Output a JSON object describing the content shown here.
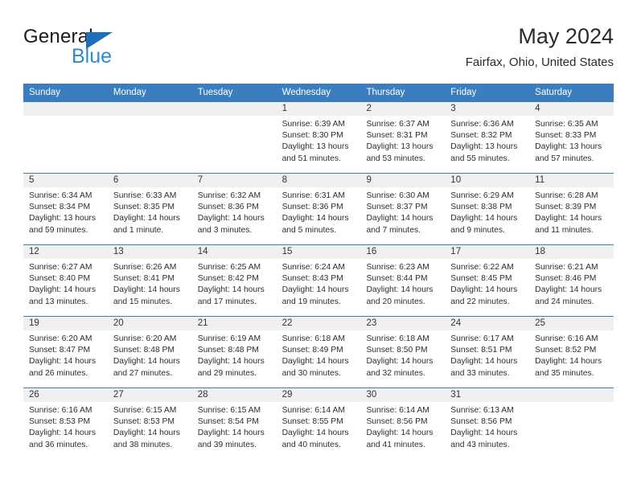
{
  "brand": {
    "name_part1": "General",
    "name_part2": "Blue",
    "triangle_color": "#1d6fb8",
    "blue_color": "#2e8bd0"
  },
  "header": {
    "title": "May 2024",
    "location": "Fairfax, Ohio, United States"
  },
  "theme": {
    "header_bar": "#3a7ebf",
    "date_band": "#f0f0f0",
    "text": "#2d2d2d"
  },
  "weekday_headers": [
    "Sunday",
    "Monday",
    "Tuesday",
    "Wednesday",
    "Thursday",
    "Friday",
    "Saturday"
  ],
  "weeks": [
    [
      {
        "day": "",
        "sunrise": "",
        "sunset": "",
        "daylight_line1": "",
        "daylight_line2": ""
      },
      {
        "day": "",
        "sunrise": "",
        "sunset": "",
        "daylight_line1": "",
        "daylight_line2": ""
      },
      {
        "day": "",
        "sunrise": "",
        "sunset": "",
        "daylight_line1": "",
        "daylight_line2": ""
      },
      {
        "day": "1",
        "sunrise": "Sunrise: 6:39 AM",
        "sunset": "Sunset: 8:30 PM",
        "daylight_line1": "Daylight: 13 hours",
        "daylight_line2": "and 51 minutes."
      },
      {
        "day": "2",
        "sunrise": "Sunrise: 6:37 AM",
        "sunset": "Sunset: 8:31 PM",
        "daylight_line1": "Daylight: 13 hours",
        "daylight_line2": "and 53 minutes."
      },
      {
        "day": "3",
        "sunrise": "Sunrise: 6:36 AM",
        "sunset": "Sunset: 8:32 PM",
        "daylight_line1": "Daylight: 13 hours",
        "daylight_line2": "and 55 minutes."
      },
      {
        "day": "4",
        "sunrise": "Sunrise: 6:35 AM",
        "sunset": "Sunset: 8:33 PM",
        "daylight_line1": "Daylight: 13 hours",
        "daylight_line2": "and 57 minutes."
      }
    ],
    [
      {
        "day": "5",
        "sunrise": "Sunrise: 6:34 AM",
        "sunset": "Sunset: 8:34 PM",
        "daylight_line1": "Daylight: 13 hours",
        "daylight_line2": "and 59 minutes."
      },
      {
        "day": "6",
        "sunrise": "Sunrise: 6:33 AM",
        "sunset": "Sunset: 8:35 PM",
        "daylight_line1": "Daylight: 14 hours",
        "daylight_line2": "and 1 minute."
      },
      {
        "day": "7",
        "sunrise": "Sunrise: 6:32 AM",
        "sunset": "Sunset: 8:36 PM",
        "daylight_line1": "Daylight: 14 hours",
        "daylight_line2": "and 3 minutes."
      },
      {
        "day": "8",
        "sunrise": "Sunrise: 6:31 AM",
        "sunset": "Sunset: 8:36 PM",
        "daylight_line1": "Daylight: 14 hours",
        "daylight_line2": "and 5 minutes."
      },
      {
        "day": "9",
        "sunrise": "Sunrise: 6:30 AM",
        "sunset": "Sunset: 8:37 PM",
        "daylight_line1": "Daylight: 14 hours",
        "daylight_line2": "and 7 minutes."
      },
      {
        "day": "10",
        "sunrise": "Sunrise: 6:29 AM",
        "sunset": "Sunset: 8:38 PM",
        "daylight_line1": "Daylight: 14 hours",
        "daylight_line2": "and 9 minutes."
      },
      {
        "day": "11",
        "sunrise": "Sunrise: 6:28 AM",
        "sunset": "Sunset: 8:39 PM",
        "daylight_line1": "Daylight: 14 hours",
        "daylight_line2": "and 11 minutes."
      }
    ],
    [
      {
        "day": "12",
        "sunrise": "Sunrise: 6:27 AM",
        "sunset": "Sunset: 8:40 PM",
        "daylight_line1": "Daylight: 14 hours",
        "daylight_line2": "and 13 minutes."
      },
      {
        "day": "13",
        "sunrise": "Sunrise: 6:26 AM",
        "sunset": "Sunset: 8:41 PM",
        "daylight_line1": "Daylight: 14 hours",
        "daylight_line2": "and 15 minutes."
      },
      {
        "day": "14",
        "sunrise": "Sunrise: 6:25 AM",
        "sunset": "Sunset: 8:42 PM",
        "daylight_line1": "Daylight: 14 hours",
        "daylight_line2": "and 17 minutes."
      },
      {
        "day": "15",
        "sunrise": "Sunrise: 6:24 AM",
        "sunset": "Sunset: 8:43 PM",
        "daylight_line1": "Daylight: 14 hours",
        "daylight_line2": "and 19 minutes."
      },
      {
        "day": "16",
        "sunrise": "Sunrise: 6:23 AM",
        "sunset": "Sunset: 8:44 PM",
        "daylight_line1": "Daylight: 14 hours",
        "daylight_line2": "and 20 minutes."
      },
      {
        "day": "17",
        "sunrise": "Sunrise: 6:22 AM",
        "sunset": "Sunset: 8:45 PM",
        "daylight_line1": "Daylight: 14 hours",
        "daylight_line2": "and 22 minutes."
      },
      {
        "day": "18",
        "sunrise": "Sunrise: 6:21 AM",
        "sunset": "Sunset: 8:46 PM",
        "daylight_line1": "Daylight: 14 hours",
        "daylight_line2": "and 24 minutes."
      }
    ],
    [
      {
        "day": "19",
        "sunrise": "Sunrise: 6:20 AM",
        "sunset": "Sunset: 8:47 PM",
        "daylight_line1": "Daylight: 14 hours",
        "daylight_line2": "and 26 minutes."
      },
      {
        "day": "20",
        "sunrise": "Sunrise: 6:20 AM",
        "sunset": "Sunset: 8:48 PM",
        "daylight_line1": "Daylight: 14 hours",
        "daylight_line2": "and 27 minutes."
      },
      {
        "day": "21",
        "sunrise": "Sunrise: 6:19 AM",
        "sunset": "Sunset: 8:48 PM",
        "daylight_line1": "Daylight: 14 hours",
        "daylight_line2": "and 29 minutes."
      },
      {
        "day": "22",
        "sunrise": "Sunrise: 6:18 AM",
        "sunset": "Sunset: 8:49 PM",
        "daylight_line1": "Daylight: 14 hours",
        "daylight_line2": "and 30 minutes."
      },
      {
        "day": "23",
        "sunrise": "Sunrise: 6:18 AM",
        "sunset": "Sunset: 8:50 PM",
        "daylight_line1": "Daylight: 14 hours",
        "daylight_line2": "and 32 minutes."
      },
      {
        "day": "24",
        "sunrise": "Sunrise: 6:17 AM",
        "sunset": "Sunset: 8:51 PM",
        "daylight_line1": "Daylight: 14 hours",
        "daylight_line2": "and 33 minutes."
      },
      {
        "day": "25",
        "sunrise": "Sunrise: 6:16 AM",
        "sunset": "Sunset: 8:52 PM",
        "daylight_line1": "Daylight: 14 hours",
        "daylight_line2": "and 35 minutes."
      }
    ],
    [
      {
        "day": "26",
        "sunrise": "Sunrise: 6:16 AM",
        "sunset": "Sunset: 8:53 PM",
        "daylight_line1": "Daylight: 14 hours",
        "daylight_line2": "and 36 minutes."
      },
      {
        "day": "27",
        "sunrise": "Sunrise: 6:15 AM",
        "sunset": "Sunset: 8:53 PM",
        "daylight_line1": "Daylight: 14 hours",
        "daylight_line2": "and 38 minutes."
      },
      {
        "day": "28",
        "sunrise": "Sunrise: 6:15 AM",
        "sunset": "Sunset: 8:54 PM",
        "daylight_line1": "Daylight: 14 hours",
        "daylight_line2": "and 39 minutes."
      },
      {
        "day": "29",
        "sunrise": "Sunrise: 6:14 AM",
        "sunset": "Sunset: 8:55 PM",
        "daylight_line1": "Daylight: 14 hours",
        "daylight_line2": "and 40 minutes."
      },
      {
        "day": "30",
        "sunrise": "Sunrise: 6:14 AM",
        "sunset": "Sunset: 8:56 PM",
        "daylight_line1": "Daylight: 14 hours",
        "daylight_line2": "and 41 minutes."
      },
      {
        "day": "31",
        "sunrise": "Sunrise: 6:13 AM",
        "sunset": "Sunset: 8:56 PM",
        "daylight_line1": "Daylight: 14 hours",
        "daylight_line2": "and 43 minutes."
      },
      {
        "day": "",
        "sunrise": "",
        "sunset": "",
        "daylight_line1": "",
        "daylight_line2": ""
      }
    ]
  ]
}
